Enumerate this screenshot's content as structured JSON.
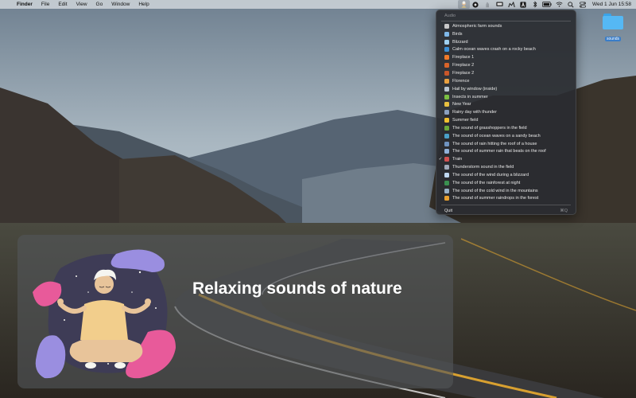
{
  "menubar": {
    "app_name": "Finder",
    "menus": [
      "File",
      "Edit",
      "View",
      "Go",
      "Window",
      "Help"
    ],
    "status_icons": [
      "nature-sound-app-icon",
      "record-icon",
      "hand-icon",
      "display-icon",
      "airdrop-icon",
      "text-input-icon",
      "bluetooth-icon",
      "battery-icon",
      "wifi-icon",
      "search-icon",
      "control-center-icon"
    ],
    "clock": "Wed 1 Jun  15:58"
  },
  "desktop": {
    "folder_label": "sounds"
  },
  "dropdown": {
    "header": "Audio",
    "items": [
      {
        "label": "Atmospheric farm sounds",
        "icon_color": "#c8c8c8",
        "checked": false
      },
      {
        "label": "Birds",
        "icon_color": "#7fb8e8",
        "checked": false
      },
      {
        "label": "Blizzard",
        "icon_color": "#9fd0f0",
        "checked": false
      },
      {
        "label": "Calm ocean waves crash on a rocky beach",
        "icon_color": "#3b8fd6",
        "checked": false
      },
      {
        "label": "Fireplace 1",
        "icon_color": "#f07a2a",
        "checked": false
      },
      {
        "label": "Fireplace 2",
        "icon_color": "#d9642a",
        "checked": false
      },
      {
        "label": "Fireplace 2",
        "icon_color": "#c9562a",
        "checked": false
      },
      {
        "label": "Florence",
        "icon_color": "#e8a040",
        "checked": false
      },
      {
        "label": "Hail by window (inside)",
        "icon_color": "#b8c4d0",
        "checked": false
      },
      {
        "label": "Insects in summer",
        "icon_color": "#7bc043",
        "checked": false
      },
      {
        "label": "New Year",
        "icon_color": "#e8c040",
        "checked": false
      },
      {
        "label": "Rainy day with thunder",
        "icon_color": "#8aa0c0",
        "checked": false
      },
      {
        "label": "Summer field",
        "icon_color": "#f0c030",
        "checked": false
      },
      {
        "label": "The sound of grasshoppers in the field",
        "icon_color": "#6aa83a",
        "checked": false
      },
      {
        "label": "The sound of ocean waves on a sandy beach",
        "icon_color": "#4aa0c8",
        "checked": false
      },
      {
        "label": "The sound of rain hitting the roof of a house",
        "icon_color": "#6f93c0",
        "checked": false
      },
      {
        "label": "The sound of summer rain that beats on the roof",
        "icon_color": "#90b0d8",
        "checked": false
      },
      {
        "label": "Train",
        "icon_color": "#d05050",
        "checked": true
      },
      {
        "label": "Thunderstorm sound in the field",
        "icon_color": "#a0a8b8",
        "checked": false
      },
      {
        "label": "The sound of the wind during a blizzard",
        "icon_color": "#c0d8f0",
        "checked": false
      },
      {
        "label": "The sound of the rainforest at night",
        "icon_color": "#3a9050",
        "checked": false
      },
      {
        "label": "The sound of the cold wind in the mountains",
        "icon_color": "#98b0c8",
        "checked": false
      },
      {
        "label": "The sound of summer raindrops in the forest",
        "icon_color": "#e8a030",
        "checked": false
      }
    ],
    "quit_label": "Quit",
    "quit_shortcut": "⌘Q"
  },
  "card": {
    "headline": "Relaxing sounds of nature"
  },
  "colors": {
    "menu_bg": "#2a2c30",
    "menu_text": "#e8e8e8",
    "card_bg": "#525658",
    "accent_purple": "#9a8ee0",
    "accent_pink": "#e85a9a"
  }
}
